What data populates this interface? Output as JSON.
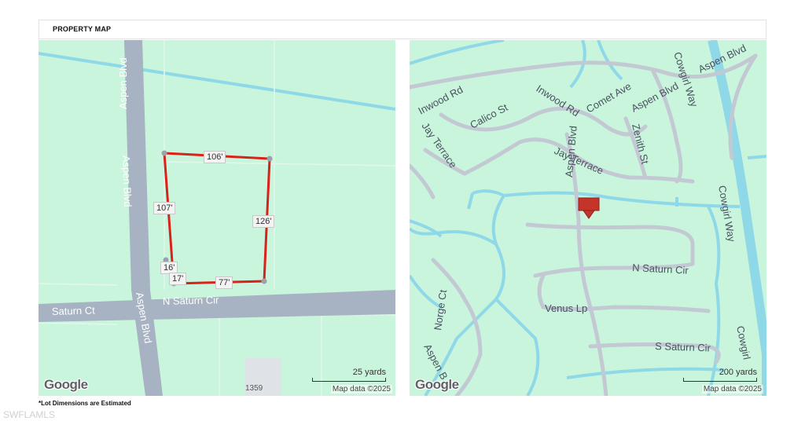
{
  "header": {
    "title": "PROPERTY MAP"
  },
  "left_map": {
    "roads": [
      "Aspen Blvd",
      "Aspen Blvd",
      "Aspen Blvd",
      "Saturn Ct",
      "N Saturn Cir"
    ],
    "lot_dimensions": [
      "106'",
      "107'",
      "126'",
      "16'",
      "17'",
      "77'"
    ],
    "parcel_number": "1359",
    "scale_label": "25 yards",
    "google_logo": "Google",
    "attribution": "Map data ©2025",
    "colors": {
      "land": "#c9f5dd",
      "road": "#a7b2c2",
      "water": "#8fd8e8",
      "lot_outline": "#d9221c"
    }
  },
  "right_map": {
    "roads": [
      "Inwood Rd",
      "Calico St",
      "Inwood Rd",
      "Comet Ave",
      "Aspen Blvd",
      "Cowgirl Way",
      "Aspen Blvd",
      "Jay Terrace",
      "Jay Terrace",
      "Zenith St",
      "Aspen Blvd",
      "Cowgirl Way",
      "N Saturn Cir",
      "Venus Lp",
      "Norge Ct",
      "S Saturn Cir",
      "Cowgirl",
      "Aspen B"
    ],
    "marker_icon": "location-pin-icon",
    "scale_label": "200 yards",
    "google_logo": "Google",
    "attribution": "Map data ©2025",
    "colors": {
      "marker": "#c4342b"
    }
  },
  "footnote": "*Lot Dimensions are Estimated",
  "watermark": "SWFLAMLS"
}
